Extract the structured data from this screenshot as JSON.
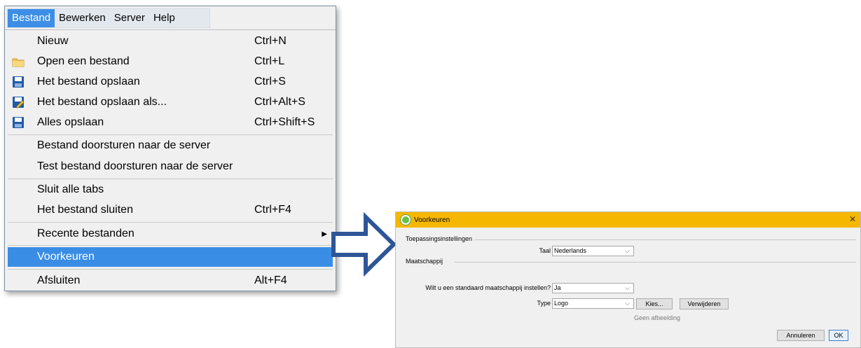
{
  "menubar": {
    "items": [
      "Bestand",
      "Bewerken",
      "Server",
      "Help"
    ]
  },
  "menu": {
    "items": [
      {
        "label": "Nieuw",
        "shortcut": "Ctrl+N",
        "icon": "none"
      },
      {
        "label": "Open een bestand",
        "shortcut": "Ctrl+L",
        "icon": "folder-icon"
      },
      {
        "label": "Het bestand opslaan",
        "shortcut": "Ctrl+S",
        "icon": "save-icon"
      },
      {
        "label": "Het bestand opslaan als...",
        "shortcut": "Ctrl+Alt+S",
        "icon": "save-as-icon"
      },
      {
        "label": "Alles opslaan",
        "shortcut": "Ctrl+Shift+S",
        "icon": "save-all-icon"
      },
      {
        "label": "Bestand doorsturen naar de server",
        "shortcut": ""
      },
      {
        "label": "Test bestand doorsturen naar de server",
        "shortcut": ""
      },
      {
        "label": "Sluit alle tabs",
        "shortcut": ""
      },
      {
        "label": "Het bestand sluiten",
        "shortcut": "Ctrl+F4"
      },
      {
        "label": "Recente bestanden",
        "shortcut": "",
        "submenu_glyph": "▶"
      },
      {
        "label": "Voorkeuren",
        "shortcut": "",
        "selected": true
      },
      {
        "label": "Afsluiten",
        "shortcut": "Alt+F4"
      }
    ]
  },
  "dialog": {
    "title": "Voorkeuren",
    "close_glyph": "✕",
    "section_app": "Toepassingsinstellingen",
    "language_label": "Taal",
    "language_value": "Nederlands",
    "section_company": "Maatschappij",
    "default_company_label": "Wilt u een standaard maatschappij instellen?",
    "default_company_value": "Ja",
    "type_label": "Type",
    "type_value": "Logo",
    "choose_button": "Kies...",
    "remove_button": "Verwijderen",
    "no_image_text": "Geen afbeelding",
    "cancel_button": "Annuleren",
    "ok_button": "OK",
    "chevron_glyph": "⌵"
  },
  "colors": {
    "menu_highlight": "#3a8de4",
    "dialog_title_bar": "#f6b700",
    "arrow_stroke": "#2f5597"
  }
}
